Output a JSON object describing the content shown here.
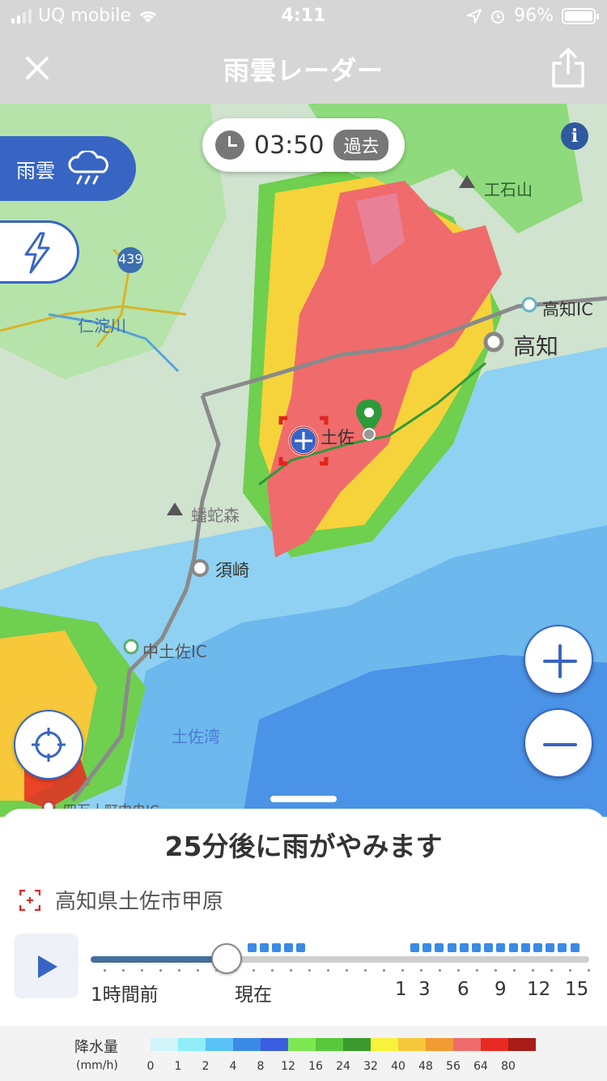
{
  "status_bar": {
    "carrier": "UQ mobile",
    "time": "4:11",
    "battery": "96%"
  },
  "header": {
    "title": "雨雲レーダー"
  },
  "time_pill": {
    "time": "03:50",
    "badge": "過去"
  },
  "layer_tab": {
    "label": "雨雲"
  },
  "map_labels": {
    "kochi_ic": "高知IC",
    "kochi": "高知",
    "tosa": "土佐",
    "susaki": "須崎",
    "nakatosa_ic": "中土佐IC",
    "tosa_bay": "土佐湾",
    "niyodo_river": "仁淀川",
    "banjamori": "蟠蛇森",
    "kuishiyama": "工石山",
    "route": "439",
    "shimanto_ic": "四万十町中央IC"
  },
  "forecast": {
    "headline": "25分後に雨がやみます",
    "location": "高知県土佐市甲原"
  },
  "timeline": {
    "ticks": [
      "1時間前",
      "現在",
      "1",
      "3",
      "6",
      "9",
      "12",
      "15"
    ],
    "current_position": 0.27
  },
  "legend": {
    "title": "降水量",
    "unit": "(mm/h)",
    "levels": [
      "0",
      "1",
      "2",
      "4",
      "8",
      "12",
      "16",
      "24",
      "32",
      "40",
      "48",
      "56",
      "64",
      "80"
    ],
    "colors": [
      "#cff5fb",
      "#8feef9",
      "#5ac2f5",
      "#3a8ae6",
      "#3b5ee0",
      "#7ee852",
      "#58c93c",
      "#3a9a2e",
      "#f7f23c",
      "#f6c83a",
      "#f29a33",
      "#f06b6b",
      "#e82b22",
      "#a81d17"
    ]
  },
  "colors": {
    "accent": "#3865c4"
  }
}
